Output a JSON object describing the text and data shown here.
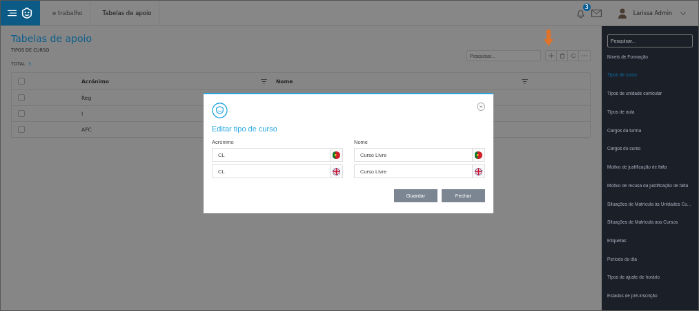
{
  "topbar": {
    "breadcrumbs": [
      {
        "label": "e trabalho",
        "selected": false
      },
      {
        "label": "Tabelas de apoio",
        "selected": true
      }
    ],
    "notifications": {
      "count": "3"
    },
    "user": {
      "name": "Larissa Admin"
    }
  },
  "page": {
    "title": "Tabelas de apoio",
    "subtitle": "TIPOS DE CURSO",
    "total_label": "TOTAL",
    "total": "3",
    "search": {
      "placeholder": "Pesquisar..."
    }
  },
  "table": {
    "select_all_checked": false,
    "columns": [
      "Acrónimo",
      "Nome"
    ],
    "rows": [
      {
        "acronym": "Reg",
        "checked": false
      },
      {
        "acronym": "I",
        "checked": false
      },
      {
        "acronym": "AFC",
        "checked": false
      }
    ]
  },
  "sidebar": {
    "search": {
      "placeholder": "Pesquisar..."
    },
    "items": [
      {
        "label": "Níveis de Formação",
        "selected": false
      },
      {
        "label": "Tipos de curso",
        "selected": true
      },
      {
        "label": "Tipos de unidade curricular",
        "selected": false
      },
      {
        "label": "Tipos de aula",
        "selected": false
      },
      {
        "label": "Cargos da turma",
        "selected": false
      },
      {
        "label": "Cargos do curso",
        "selected": false
      },
      {
        "label": "Motivo de justificação de falta",
        "selected": false
      },
      {
        "label": "Motivo de recusa da justificação de falta",
        "selected": false
      },
      {
        "label": "Situações de Matrícula às Unidades Cu...",
        "selected": false
      },
      {
        "label": "Situações de Matrícula aos Cursos",
        "selected": false
      },
      {
        "label": "Etiquetas",
        "selected": false
      },
      {
        "label": "Período do dia",
        "selected": false
      },
      {
        "label": "Tipos de ajuste de horário",
        "selected": false
      },
      {
        "label": "Estados de pré-inscrição",
        "selected": false
      }
    ]
  },
  "modal": {
    "title": "Editar tipo de curso",
    "fields": [
      {
        "label": "Acrónimo",
        "values": [
          {
            "value": "CL",
            "kind": "pt"
          },
          {
            "value": "CL",
            "kind": "gb"
          }
        ]
      },
      {
        "label": "Nome",
        "values": [
          {
            "value": "Curso Livre",
            "kind": "pt"
          },
          {
            "value": "Curso Livre",
            "kind": "gb"
          }
        ]
      }
    ],
    "buttons": [
      "Guardar",
      "Fechar"
    ]
  }
}
